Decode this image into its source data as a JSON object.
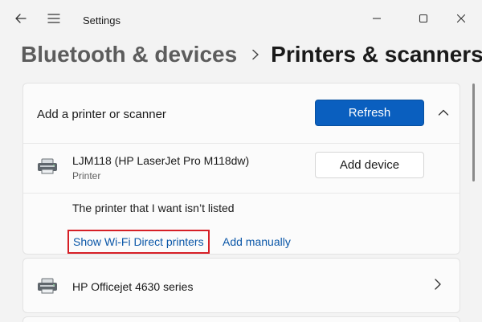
{
  "window": {
    "title": "Settings",
    "icons": {
      "back": "back-arrow-icon",
      "menu": "hamburger-menu-icon",
      "minimize": "minimize-icon",
      "maximize": "maximize-icon",
      "close": "close-icon"
    }
  },
  "breadcrumb": {
    "parent": "Bluetooth & devices",
    "separator_icon": "chevron-right-icon",
    "current": "Printers & scanners"
  },
  "add_section": {
    "label": "Add a printer or scanner",
    "refresh_label": "Refresh",
    "expanded_icon": "chevron-up-icon",
    "accent_color": "#0a5fbf"
  },
  "found_printers": [
    {
      "name": "LJM118 (HP LaserJet Pro M118dw)",
      "type": "Printer",
      "icon": "printer-icon",
      "action_label": "Add device"
    }
  ],
  "not_listed": {
    "text": "The printer that I want isn’t listed",
    "wifi_direct_link": "Show Wi-Fi Direct printers",
    "add_manually_link": "Add manually",
    "highlight_color": "#d61f26"
  },
  "installed_printers": [
    {
      "name": "HP Officejet 4630 series",
      "icon": "printer-icon",
      "chevron": "chevron-right-icon"
    }
  ]
}
